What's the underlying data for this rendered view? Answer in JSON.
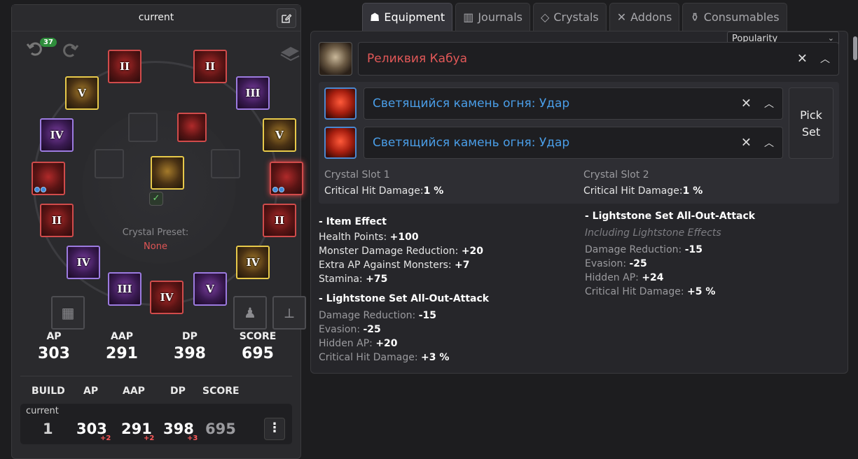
{
  "left": {
    "title": "current",
    "undo_count": "37",
    "preset_label": "Crystal Preset:",
    "preset_value": "None",
    "slots": [
      {
        "tier": "II"
      },
      {
        "tier": "II"
      },
      {
        "tier": "V"
      },
      {
        "tier": "III"
      },
      {
        "tier": "IV"
      },
      {
        "tier": "V"
      },
      {
        "tier": ""
      },
      {
        "tier": ""
      },
      {
        "tier": "II"
      },
      {
        "tier": "II"
      },
      {
        "tier": "IV"
      },
      {
        "tier": "IV"
      },
      {
        "tier": "III"
      },
      {
        "tier": "IV"
      },
      {
        "tier": "V"
      }
    ],
    "stats": [
      {
        "label": "AP",
        "value": "303"
      },
      {
        "label": "AAP",
        "value": "291"
      },
      {
        "label": "DP",
        "value": "398"
      },
      {
        "label": "SCORE",
        "value": "695"
      }
    ],
    "compare_headers": [
      "BUILD",
      "AP",
      "AAP",
      "DP",
      "SCORE"
    ],
    "compare_row": {
      "name": "current",
      "build": "1",
      "ap": "303",
      "ap_delta": "+2",
      "aap": "291",
      "aap_delta": "+2",
      "dp": "398",
      "dp_delta": "+3",
      "score": "695"
    }
  },
  "tabs": [
    {
      "label": "Equipment",
      "icon": "helmet-icon"
    },
    {
      "label": "Journals",
      "icon": "books-icon"
    },
    {
      "label": "Crystals",
      "icon": "crystal-icon"
    },
    {
      "label": "Addons",
      "icon": "crossed-tools-icon"
    },
    {
      "label": "Consumables",
      "icon": "potion-icon"
    }
  ],
  "sort": {
    "selected": "Popularity"
  },
  "item": {
    "name": "Реликвия Кабуа",
    "name_color": "#e25858"
  },
  "crystals": [
    {
      "name": "Светящийся камень огня: Удар",
      "color": "#4a9ee8"
    },
    {
      "name": "Светящийся камень огня: Удар",
      "color": "#4a9ee8"
    }
  ],
  "pick_set": [
    "Pick",
    "Set"
  ],
  "slot_stats": [
    {
      "title": "Crystal Slot 1",
      "stat": "Critical Hit Damage:",
      "value": "1 %"
    },
    {
      "title": "Crystal Slot 2",
      "stat": "Critical Hit Damage:",
      "value": "1 %"
    }
  ],
  "item_effect": {
    "title": "- Item Effect",
    "lines": [
      {
        "k": "Health Points: ",
        "v": "+100"
      },
      {
        "k": "Monster Damage Reduction: ",
        "v": "+20"
      },
      {
        "k": "Extra AP Against Monsters: ",
        "v": "+7"
      },
      {
        "k": "Stamina: ",
        "v": "+75"
      }
    ]
  },
  "set_effect_left": {
    "title": "- Lightstone Set All-Out-Attack",
    "lines": [
      {
        "k": "Damage Reduction: ",
        "v": "-15"
      },
      {
        "k": "Evasion: ",
        "v": "-25"
      },
      {
        "k": "Hidden AP: ",
        "v": "+20"
      },
      {
        "k": "Critical Hit Damage: ",
        "v": "+3 %"
      }
    ]
  },
  "set_effect_right": {
    "title": "- Lightstone Set All-Out-Attack",
    "subtitle": "Including Lightstone Effects",
    "lines": [
      {
        "k": "Damage Reduction: ",
        "v": "-15"
      },
      {
        "k": "Evasion: ",
        "v": "-25"
      },
      {
        "k": "Hidden AP: ",
        "v": "+24"
      },
      {
        "k": "Critical Hit Damage: ",
        "v": "+5 %"
      }
    ]
  }
}
